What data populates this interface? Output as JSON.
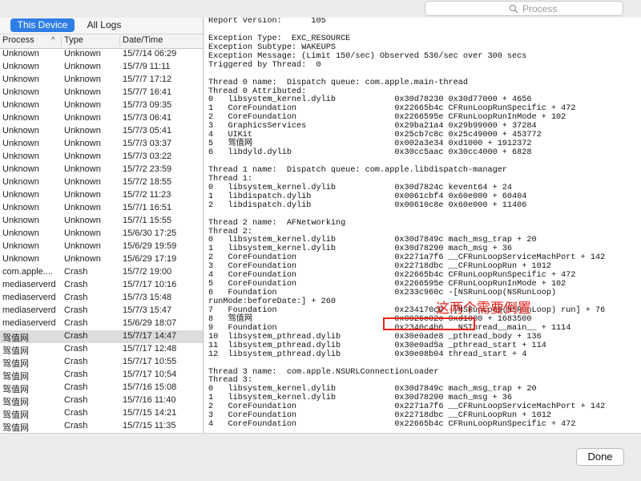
{
  "search": {
    "placeholder": "Process"
  },
  "segments": {
    "this_device": "This Device",
    "all_logs": "All Logs",
    "selected": "This Device"
  },
  "columns": {
    "process": "Process",
    "type": "Type",
    "datetime": "Date/Time",
    "sort_indicator": "^"
  },
  "rows": [
    {
      "process": "Unknown",
      "type": "Unknown",
      "date": "15/7/14 06:29"
    },
    {
      "process": "Unknown",
      "type": "Unknown",
      "date": "15/7/9 11:11"
    },
    {
      "process": "Unknown",
      "type": "Unknown",
      "date": "15/7/7 17:12"
    },
    {
      "process": "Unknown",
      "type": "Unknown",
      "date": "15/7/7 16:41"
    },
    {
      "process": "Unknown",
      "type": "Unknown",
      "date": "15/7/3 09:35"
    },
    {
      "process": "Unknown",
      "type": "Unknown",
      "date": "15/7/3 06:41"
    },
    {
      "process": "Unknown",
      "type": "Unknown",
      "date": "15/7/3 05:41"
    },
    {
      "process": "Unknown",
      "type": "Unknown",
      "date": "15/7/3 03:37"
    },
    {
      "process": "Unknown",
      "type": "Unknown",
      "date": "15/7/3 03:22"
    },
    {
      "process": "Unknown",
      "type": "Unknown",
      "date": "15/7/2 23:59"
    },
    {
      "process": "Unknown",
      "type": "Unknown",
      "date": "15/7/2 18:55"
    },
    {
      "process": "Unknown",
      "type": "Unknown",
      "date": "15/7/2 11:23"
    },
    {
      "process": "Unknown",
      "type": "Unknown",
      "date": "15/7/1 16:51"
    },
    {
      "process": "Unknown",
      "type": "Unknown",
      "date": "15/7/1 15:55"
    },
    {
      "process": "Unknown",
      "type": "Unknown",
      "date": "15/6/30 17:25"
    },
    {
      "process": "Unknown",
      "type": "Unknown",
      "date": "15/6/29 19:59"
    },
    {
      "process": "Unknown",
      "type": "Unknown",
      "date": "15/6/29 17:19"
    },
    {
      "process": "com.apple....",
      "type": "Crash",
      "date": "15/7/2 19:00"
    },
    {
      "process": "mediaserverd",
      "type": "Crash",
      "date": "15/7/17 10:16"
    },
    {
      "process": "mediaserverd",
      "type": "Crash",
      "date": "15/7/3 15:48"
    },
    {
      "process": "mediaserverd",
      "type": "Crash",
      "date": "15/7/3 15:47"
    },
    {
      "process": "mediaserverd",
      "type": "Crash",
      "date": "15/6/29 18:07"
    },
    {
      "process": "驾值网",
      "type": "Crash",
      "date": "15/7/17 14:47",
      "selected": true
    },
    {
      "process": "驾值网",
      "type": "Crash",
      "date": "15/7/17 12:48"
    },
    {
      "process": "驾值网",
      "type": "Crash",
      "date": "15/7/17 10:55"
    },
    {
      "process": "驾值网",
      "type": "Crash",
      "date": "15/7/17 10:54"
    },
    {
      "process": "驾值网",
      "type": "Crash",
      "date": "15/7/16 15:08"
    },
    {
      "process": "驾值网",
      "type": "Crash",
      "date": "15/7/16 11:40"
    },
    {
      "process": "驾值网",
      "type": "Crash",
      "date": "15/7/15 14:21"
    },
    {
      "process": "驾值网",
      "type": "Crash",
      "date": "15/7/15 11:35"
    }
  ],
  "log_lines": [
    "Report Version:      105",
    "",
    "Exception Type:  EXC_RESOURCE",
    "Exception Subtype: WAKEUPS",
    "Exception Message: (Limit 150/sec) Observed 536/sec over 300 secs",
    "Triggered by Thread:  0",
    "",
    "Thread 0 name:  Dispatch queue: com.apple.main-thread",
    "Thread 0 Attributed:",
    "0   libsystem_kernel.dylib            0x30d78230 0x30d77000 + 4656",
    "1   CoreFoundation                    0x22665b4c CFRunLoopRunSpecific + 472",
    "2   CoreFoundation                    0x2266595e CFRunLoopRunInMode + 102",
    "3   GraphicsServices                  0x29ba21a4 0x29b99000 + 37284",
    "4   UIKit                             0x25cb7c8c 0x25c49000 + 453772",
    "5   驾值网                             0x002a3e34 0xd1000 + 1912372",
    "6   libdyld.dylib                     0x30cc5aac 0x30cc4000 + 6828",
    "",
    "Thread 1 name:  Dispatch queue: com.apple.libdispatch-manager",
    "Thread 1:",
    "0   libsystem_kernel.dylib            0x30d7824c kevent64 + 24",
    "1   libdispatch.dylib                 0x0061cbf4 0x60e000 + 60404",
    "2   libdispatch.dylib                 0x00610c8e 0x60e000 + 11406",
    "",
    "Thread 2 name:  AFNetworking",
    "Thread 2:",
    "0   libsystem_kernel.dylib            0x30d7849c mach_msg_trap + 20",
    "1   libsystem_kernel.dylib            0x30d78290 mach_msg + 36",
    "2   CoreFoundation                    0x2271a7f6 __CFRunLoopServiceMachPort + 142",
    "3   CoreFoundation                    0x22718dbc __CFRunLoopRun + 1012",
    "4   CoreFoundation                    0x22665b4c CFRunLoopRunSpecific + 472",
    "5   CoreFoundation                    0x2266595e CFRunLoopRunInMode + 102",
    "6   Foundation                        0x233c960c -[NSRunLoop(NSRunLoop)",
    "runMode:beforeDate:] + 260",
    "7   Foundation                        0x234170c0 -[NSRunLoop(NSRunLoop) run] + 76",
    "8   驾值网                             0x0026c02c 0xd1000 + 1683500",
    "9   Foundation                        0x2340c4b6 __NSThread__main__ + 1114",
    "10  libsystem_pthread.dylib           0x30e0ade8 _pthread_body + 136",
    "11  libsystem_pthread.dylib           0x30e0ad5a _pthread_start + 114",
    "12  libsystem_pthread.dylib           0x30e08b04 thread_start + 4",
    "",
    "Thread 3 name:  com.apple.NSURLConnectionLoader",
    "Thread 3:",
    "0   libsystem_kernel.dylib            0x30d7849c mach_msg_trap + 20",
    "1   libsystem_kernel.dylib            0x30d78290 mach_msg + 36",
    "2   CoreFoundation                    0x2271a7f6 __CFRunLoopServiceMachPort + 142",
    "3   CoreFoundation                    0x22718dbc __CFRunLoopRun + 1012",
    "4   CoreFoundation                    0x22665b4c CFRunLoopRunSpecific + 472"
  ],
  "annotation": {
    "text": "这两个需要倒置",
    "color": "#e8231d"
  },
  "footer": {
    "done_label": "Done"
  },
  "colors": {
    "accent": "#2f7ee6",
    "selection": "#dcdcdc",
    "annotation": "#e8231d"
  }
}
